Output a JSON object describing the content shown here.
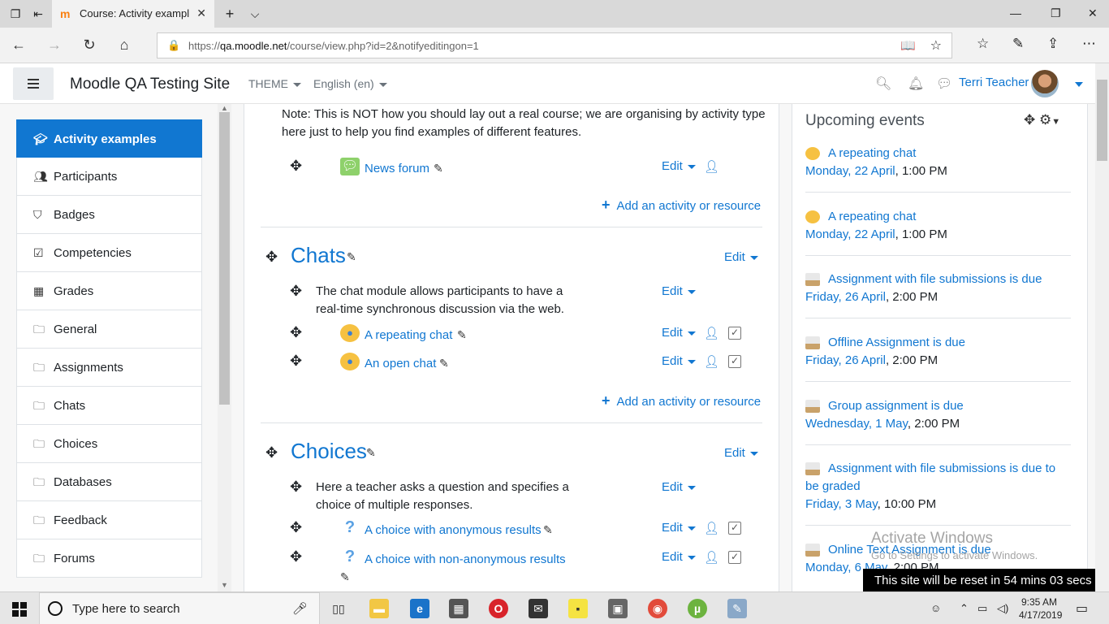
{
  "browser": {
    "tab_title": "Course: Activity exampl",
    "url_prefix": "https://",
    "url_domain": "qa.moodle.net",
    "url_path": "/course/view.php?id=2&notifyeditingon=1"
  },
  "navbar": {
    "site_name": "Moodle QA Testing Site",
    "theme_label": "THEME",
    "language_label": "English (en)",
    "user_name": "Terri Teacher"
  },
  "sidebar": {
    "items": [
      {
        "label": "Activity examples",
        "icon": "graduation-cap-icon"
      },
      {
        "label": "Participants",
        "icon": "users-icon"
      },
      {
        "label": "Badges",
        "icon": "shield-icon"
      },
      {
        "label": "Competencies",
        "icon": "checkbox-icon"
      },
      {
        "label": "Grades",
        "icon": "table-icon"
      },
      {
        "label": "General",
        "icon": "folder-icon"
      },
      {
        "label": "Assignments",
        "icon": "folder-icon"
      },
      {
        "label": "Chats",
        "icon": "folder-icon"
      },
      {
        "label": "Choices",
        "icon": "folder-icon"
      },
      {
        "label": "Databases",
        "icon": "folder-icon"
      },
      {
        "label": "Feedback",
        "icon": "folder-icon"
      },
      {
        "label": "Forums",
        "icon": "folder-icon"
      }
    ]
  },
  "main": {
    "note": "Note: This is NOT how you should lay out a real course; we are organising by activity type here just to help you find examples of different features.",
    "news_forum": "News forum",
    "edit_label": "Edit",
    "add_activity": "Add an activity or resource",
    "chats": {
      "title": "Chats",
      "summary": "The chat module allows participants to have a real-time synchronous discussion via the web.",
      "activities": [
        "A repeating chat",
        "An open chat"
      ]
    },
    "choices": {
      "title": "Choices",
      "summary": "Here a teacher asks a question and specifies a choice of multiple responses.",
      "activities": [
        "A choice with anonymous results",
        "A choice with non-anonymous results"
      ]
    }
  },
  "upcoming": {
    "title": "Upcoming events",
    "events": [
      {
        "name": "A repeating chat",
        "date_link": "Monday, 22 April",
        "time": ", 1:00 PM",
        "type": "chat"
      },
      {
        "name": "A repeating chat",
        "date_link": "Monday, 22 April",
        "time": ", 1:00 PM",
        "type": "chat"
      },
      {
        "name": "Assignment with file submissions is due",
        "date_link": "Friday, 26 April",
        "time": ", 2:00 PM",
        "type": "assign"
      },
      {
        "name": "Offline Assignment is due",
        "date_link": "Friday, 26 April",
        "time": ", 2:00 PM",
        "type": "assign"
      },
      {
        "name": "Group assignment is due",
        "date_link": "Wednesday, 1 May",
        "time": ", 2:00 PM",
        "type": "assign"
      },
      {
        "name": "Assignment with file submissions is due to be graded",
        "date_link": "Friday, 3 May",
        "time": ", 10:00 PM",
        "type": "assign"
      },
      {
        "name": "Online Text Assignment is due",
        "date_link": "Monday, 6 May",
        "time": ", 2:00 PM",
        "type": "assign"
      }
    ]
  },
  "overlay": {
    "watermark_title": "Activate Windows",
    "watermark_sub": "Go to Settings to activate Windows.",
    "reset_notice": "This site will be reset in 54 mins 03 secs"
  },
  "taskbar": {
    "search_placeholder": "Type here to search",
    "time": "9:35 AM",
    "date": "4/17/2019"
  }
}
